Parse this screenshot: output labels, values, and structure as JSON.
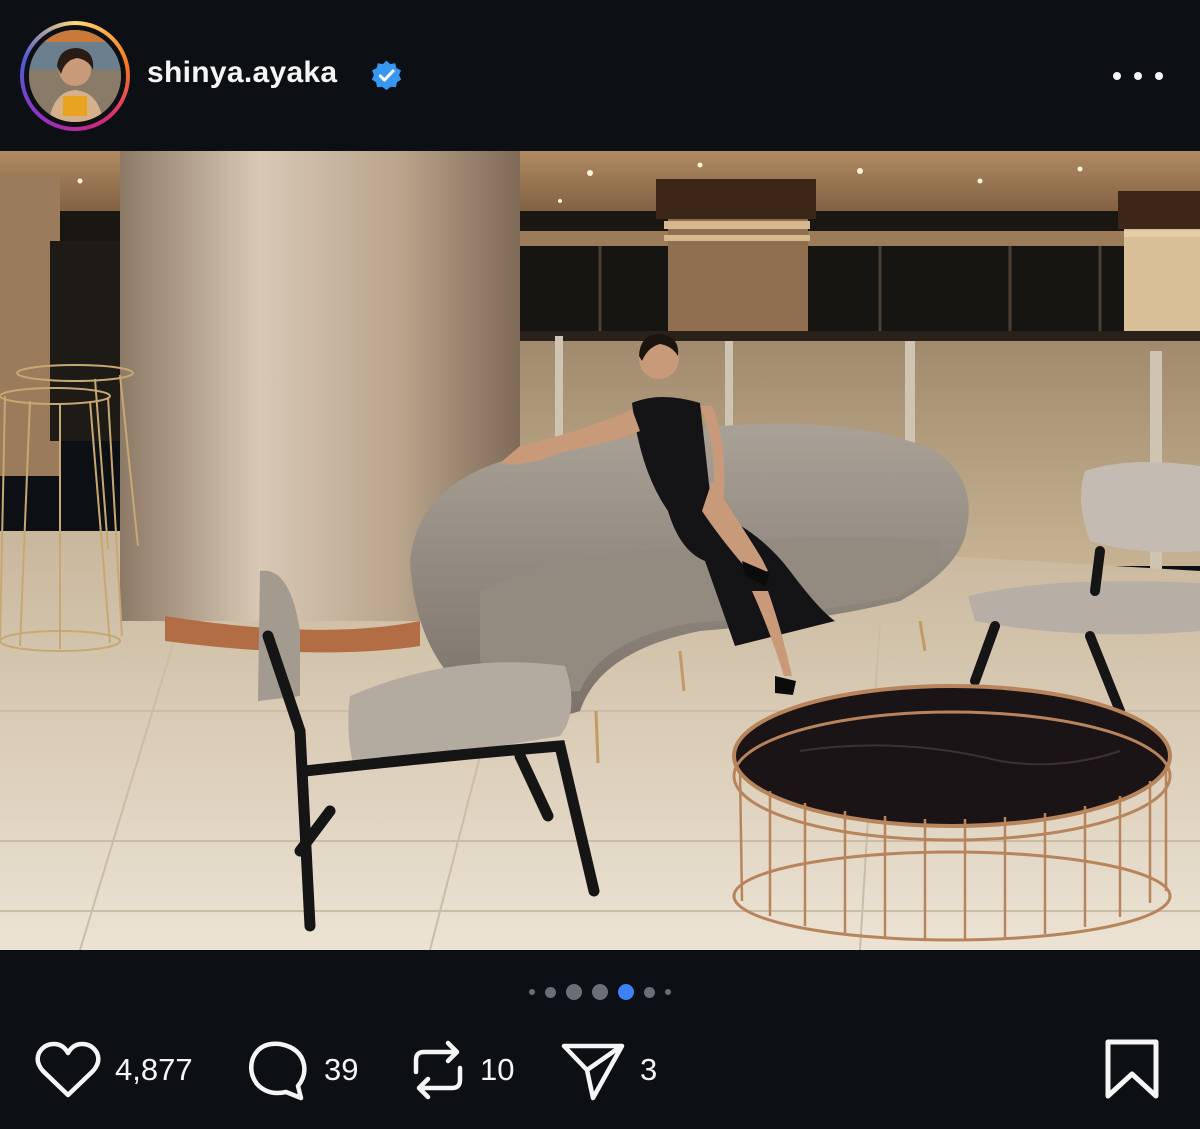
{
  "post": {
    "username": "shinya.ayaka",
    "verified": true,
    "avatar_alt": "profile photo",
    "image_alt": "Woman in black dress seated on a curved grey sofa in a hotel lobby"
  },
  "carousel": {
    "total": 7,
    "active_index": 4
  },
  "actions": {
    "likes": "4,877",
    "comments": "39",
    "reposts": "10",
    "shares": "3"
  },
  "icons": {
    "like": "heart-icon",
    "comment": "comment-bubble-icon",
    "repost": "repost-icon",
    "share": "send-icon",
    "save": "bookmark-icon",
    "more": "more-options-icon",
    "verified": "verified-badge-icon"
  },
  "colors": {
    "background": "#0c1014",
    "text": "#f5f5f5",
    "active_dot": "#3b82f6",
    "verified": "#3897f0"
  }
}
